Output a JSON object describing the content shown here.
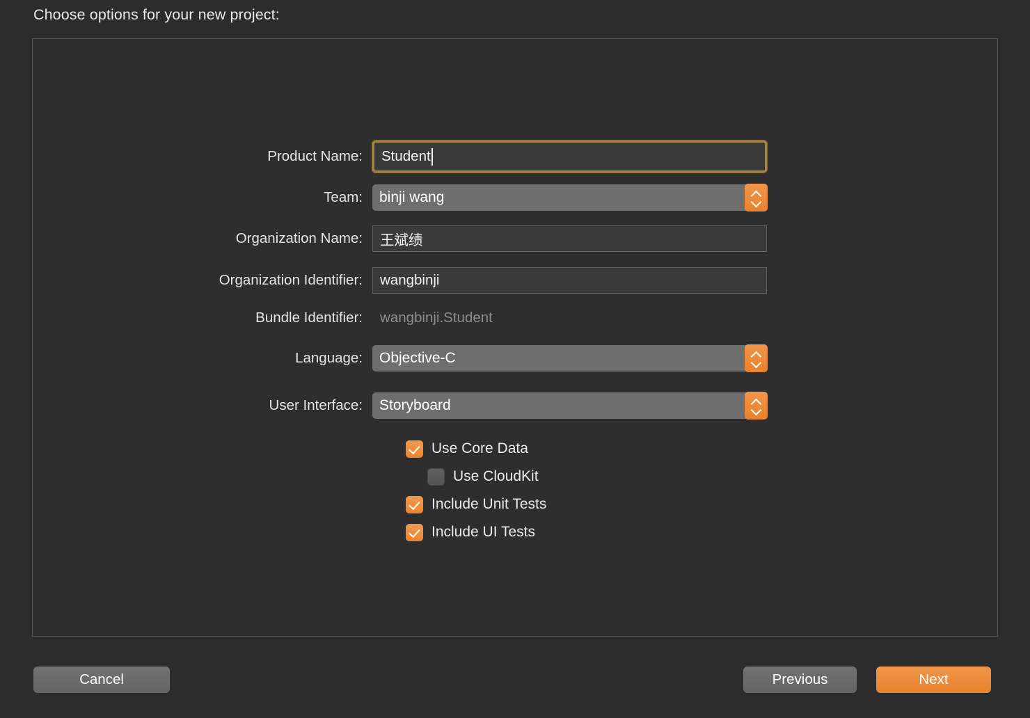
{
  "dialog": {
    "title": "Choose options for your new project:"
  },
  "form": {
    "fields": [
      {
        "label": "Product Name:",
        "value": "Student",
        "type": "text",
        "focused": true
      },
      {
        "label": "Team:",
        "value": "binji wang",
        "type": "popup"
      },
      {
        "label": "Organization Name:",
        "value": "王斌绩",
        "type": "text",
        "focused": false
      },
      {
        "label": "Organization Identifier:",
        "value": "wangbinji",
        "type": "text",
        "focused": false
      },
      {
        "label": "Bundle Identifier:",
        "value": "wangbinji.Student",
        "type": "static"
      },
      {
        "label": "Language:",
        "value": "Objective-C",
        "type": "popup"
      },
      {
        "label": "User Interface:",
        "value": "Storyboard",
        "type": "popup"
      }
    ]
  },
  "options": [
    {
      "label": "Use Core Data",
      "checked": true,
      "indented": false
    },
    {
      "label": "Use CloudKit",
      "checked": false,
      "indented": true
    },
    {
      "label": "Include Unit Tests",
      "checked": true,
      "indented": false
    },
    {
      "label": "Include UI Tests",
      "checked": true,
      "indented": false
    }
  ],
  "footer": {
    "cancel_label": "Cancel",
    "previous_label": "Previous",
    "next_label": "Next"
  },
  "colors": {
    "accent": "#e8832e",
    "focus_ring": "#a8853f",
    "window_background": "#2c2c2c",
    "panel_background": "#2e2e2e",
    "field_background": "#3a3a3a",
    "popup_background": "#6e6e6e",
    "button_gray": "#6a6a6a",
    "text_primary": "#e8e8e8",
    "text_disabled": "#8e8e8e"
  }
}
